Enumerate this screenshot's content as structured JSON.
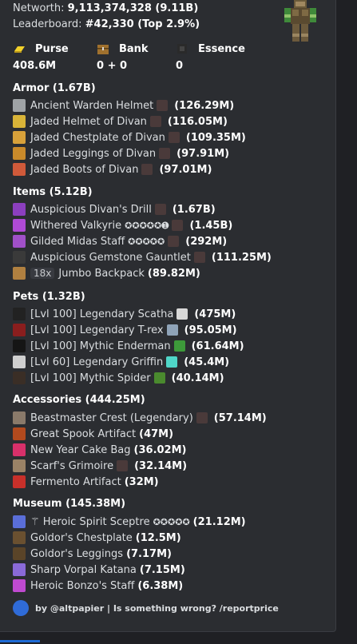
{
  "header": {
    "networth_label": "Networth:",
    "networth_value": "9,113,374,328 (9.11B)",
    "leaderboard_label": "Leaderboard:",
    "leaderboard_value": "#42,330 (Top 2.9%)"
  },
  "stats": [
    {
      "label": "Purse",
      "value": "408.6M",
      "icon": "gold-ingot-icon"
    },
    {
      "label": "Bank",
      "value": "0 + 0",
      "icon": "chest-icon"
    },
    {
      "label": "Essence",
      "value": "0",
      "icon": "essence-icon"
    }
  ],
  "sections": [
    {
      "title": "Armor (1.67B)",
      "items": [
        {
          "name": "Ancient Warden Helmet",
          "value": "(126.29M)",
          "icon": "helmet-icon",
          "extra": "gemstone-icon"
        },
        {
          "name": "Jaded Helmet of Divan",
          "value": "(116.05M)",
          "icon": "divan-helmet-icon",
          "extra": "gemstone-icon"
        },
        {
          "name": "Jaded Chestplate of Divan",
          "value": "(109.35M)",
          "icon": "chestplate-icon",
          "extra": "gemstone-icon"
        },
        {
          "name": "Jaded Leggings of Divan",
          "value": "(97.91M)",
          "icon": "leggings-icon",
          "extra": "gemstone-icon"
        },
        {
          "name": "Jaded Boots of Divan",
          "value": "(97.01M)",
          "icon": "boots-icon",
          "extra": "gemstone-icon"
        }
      ]
    },
    {
      "title": "Items (5.12B)",
      "items": [
        {
          "name": "Auspicious Divan's Drill",
          "value": "(1.67B)",
          "icon": "drill-icon",
          "extra": "gemstone-icon"
        },
        {
          "name": "Withered Valkyrie",
          "stars": "✪✪✪✪✪➊",
          "value": "(1.45B)",
          "icon": "sword-icon",
          "extra": "gemstone-icon"
        },
        {
          "name": "Gilded Midas Staff",
          "stars": "✪✪✪✪✪",
          "value": "(292M)",
          "icon": "staff-icon",
          "extra": "gemstone-icon"
        },
        {
          "name": "Auspicious Gemstone Gauntlet",
          "value": "(111.25M)",
          "icon": "gauntlet-icon",
          "extra": "gemstone-icon"
        },
        {
          "name": "Jumbo Backpack",
          "badge": "18x",
          "value": "(89.82M)",
          "icon": "backpack-icon"
        }
      ]
    },
    {
      "title": "Pets (1.32B)",
      "items": [
        {
          "name": "[Lvl 100] Legendary Scatha",
          "value": "(475M)",
          "icon": "scatha-icon",
          "extra": "pet-item-icon"
        },
        {
          "name": "[Lvl 100] Legendary T-rex",
          "value": "(95.05M)",
          "icon": "trex-icon",
          "extra": "pet-item-icon"
        },
        {
          "name": "[Lvl 100] Mythic Enderman",
          "value": "(61.64M)",
          "icon": "enderman-icon",
          "extra": "pet-item-icon"
        },
        {
          "name": "[Lvl 60] Legendary Griffin",
          "value": "(45.4M)",
          "icon": "griffin-icon",
          "extra": "pet-item-icon"
        },
        {
          "name": "[Lvl 100] Mythic Spider",
          "value": "(40.14M)",
          "icon": "spider-icon",
          "extra": "pet-item-icon"
        }
      ]
    },
    {
      "title": "Accessories (444.25M)",
      "items": [
        {
          "name": "Beastmaster Crest (Legendary)",
          "value": "(57.14M)",
          "icon": "crest-icon",
          "extra": "gemstone-icon"
        },
        {
          "name": "Great Spook Artifact",
          "value": "(47M)",
          "icon": "spook-icon"
        },
        {
          "name": "New Year Cake Bag",
          "value": "(36.02M)",
          "icon": "cake-bag-icon"
        },
        {
          "name": "Scarf's Grimoire",
          "value": "(32.14M)",
          "icon": "grimoire-icon",
          "extra": "gemstone-icon"
        },
        {
          "name": "Fermento Artifact",
          "value": "(32M)",
          "icon": "fermento-icon"
        }
      ]
    },
    {
      "title": "Museum (145.38M)",
      "items": [
        {
          "name": "⚚ Heroic Spirit Sceptre",
          "stars": "✪✪✪✪✪",
          "value": "(21.12M)",
          "icon": "sceptre-icon"
        },
        {
          "name": "Goldor's Chestplate",
          "value": "(12.5M)",
          "icon": "goldor-chestplate-icon"
        },
        {
          "name": "Goldor's Leggings",
          "value": "(7.17M)",
          "icon": "goldor-leggings-icon"
        },
        {
          "name": "Sharp Vorpal Katana",
          "value": "(7.15M)",
          "icon": "katana-icon"
        },
        {
          "name": "Heroic Bonzo's Staff",
          "value": "(6.38M)",
          "icon": "bonzo-staff-icon"
        }
      ]
    }
  ],
  "footer": {
    "text": "by @altpapier | Is something wrong? /reportprice",
    "icon": "bot-logo-icon"
  },
  "colors": {
    "embed_bg": "#2b2d31",
    "page_bg": "#1f2024",
    "text": "#dbdee1",
    "bold": "#ffffff"
  }
}
